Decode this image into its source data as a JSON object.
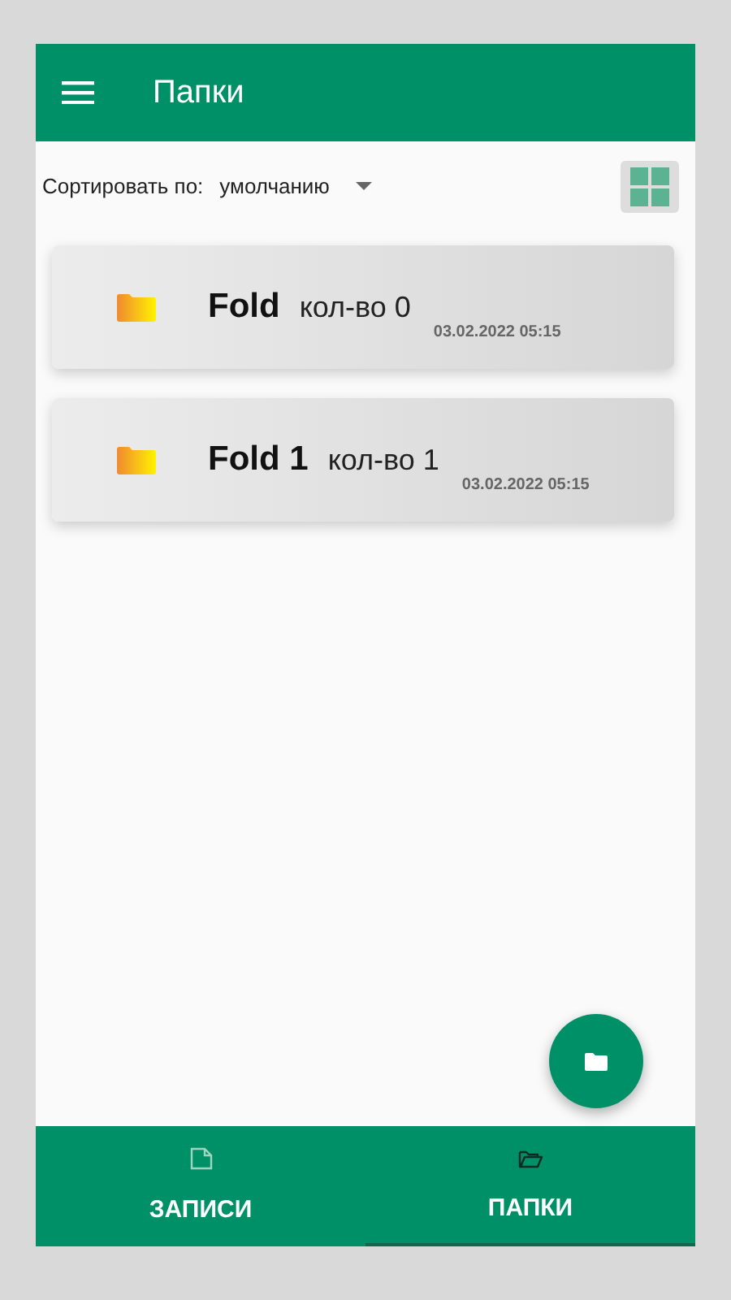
{
  "app_bar": {
    "title": "Папки"
  },
  "sort": {
    "label": "Сортировать по:",
    "value": "умолчанию"
  },
  "folders": [
    {
      "name": "Fold",
      "count": "кол-во 0",
      "date": "03.02.2022 05:15"
    },
    {
      "name": "Fold 1",
      "count": "кол-во 1",
      "date": "03.02.2022 05:15"
    }
  ],
  "bottom_nav": [
    {
      "label": "ЗАПИСИ",
      "kind": "notes",
      "selected": false
    },
    {
      "label": "ПАПКИ",
      "kind": "folders",
      "selected": true
    }
  ]
}
